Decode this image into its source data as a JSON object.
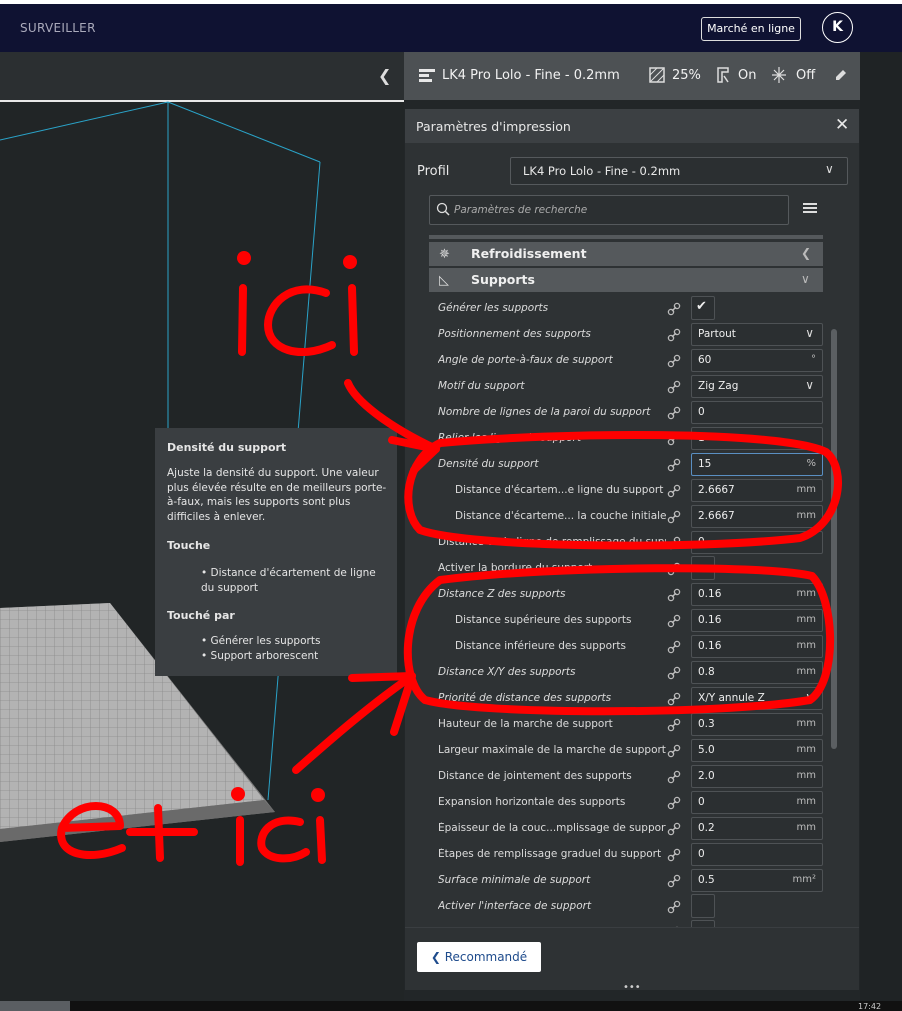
{
  "topbar": {
    "monitor": "SURVEILLER",
    "market": "Marché en ligne",
    "avatar": "K"
  },
  "header": {
    "profile": "LK4 Pro Lolo - Fine - 0.2mm",
    "infill": "25%",
    "support": "On",
    "adhesion": "Off"
  },
  "tooltip": {
    "title": "Densité du support",
    "description": "Ajuste la densité du support. Une valeur plus élevée résulte en de meilleurs porte-à-faux, mais les supports sont plus difficiles à enlever.",
    "affects_title": "Touche",
    "affects": [
      "• Distance d'écartement de ligne du support"
    ],
    "affected_by_title": "Touché par",
    "affected_by": [
      "• Générer les supports",
      "• Support arborescent"
    ]
  },
  "panel": {
    "title": "Paramètres d'impression",
    "profile_label": "Profil",
    "profile_value": "LK4 Pro Lolo - Fine - 0.2mm",
    "search_placeholder": "Paramètres de recherche",
    "categories": {
      "cooling": "Refroidissement",
      "supports": "Supports"
    },
    "rows": [
      {
        "label": "Générer les supports",
        "type": "check",
        "checked": true
      },
      {
        "label": "Positionnement des supports",
        "type": "select",
        "value": "Partout"
      },
      {
        "label": "Angle de porte-à-faux de support",
        "value": "60",
        "unit": "°"
      },
      {
        "label": "Motif du support",
        "type": "select",
        "value": "Zig Zag"
      },
      {
        "label": "Nombre de lignes de la paroi du support",
        "value": "0"
      },
      {
        "label": "Relier les lignes de support",
        "value": "1"
      },
      {
        "label": "Densité du support",
        "value": "15",
        "unit": "%",
        "focus": true
      },
      {
        "label": "Distance d'écartem...e ligne du support",
        "value": "2.6667",
        "unit": "mm",
        "indent": true
      },
      {
        "label": "Distance d'écarteme... la couche initiale",
        "value": "2.6667",
        "unit": "mm",
        "indent": true
      },
      {
        "label": "Distance de la ligne de remplissage du support",
        "value": "0"
      },
      {
        "label": "Activer la bordure du support",
        "type": "check",
        "checked": false
      },
      {
        "label": "Distance Z des supports",
        "value": "0.16",
        "unit": "mm"
      },
      {
        "label": "Distance supérieure des supports",
        "value": "0.16",
        "unit": "mm",
        "indent": true
      },
      {
        "label": "Distance inférieure des supports",
        "value": "0.16",
        "unit": "mm",
        "indent": true
      },
      {
        "label": "Distance X/Y des supports",
        "value": "0.8",
        "unit": "mm"
      },
      {
        "label": "Priorité de distance des supports",
        "type": "select",
        "value": "X/Y annule Z"
      },
      {
        "label": "Hauteur de la marche de support",
        "value": "0.3",
        "unit": "mm"
      },
      {
        "label": "Largeur maximale de la marche de support",
        "value": "5.0",
        "unit": "mm"
      },
      {
        "label": "Distance de jointement des supports",
        "value": "2.0",
        "unit": "mm"
      },
      {
        "label": "Expansion horizontale des supports",
        "value": "0",
        "unit": "mm"
      },
      {
        "label": "Épaisseur de la couc...mplissage de support",
        "value": "0.2",
        "unit": "mm"
      },
      {
        "label": "Étapes de remplissage graduel du support",
        "value": "0"
      },
      {
        "label": "Surface minimale de support",
        "value": "0.5",
        "unit": "mm²"
      },
      {
        "label": "Activer l'interface de support",
        "type": "check",
        "checked": false
      },
      {
        "label": "Activer les plafonds de support",
        "type": "check",
        "checked": false
      }
    ],
    "recommended": "Recommandé"
  },
  "annotations": {
    "text1": "ici",
    "text2": "et ici"
  },
  "clock": "17:42",
  "colors": {
    "accent": "#1e4b8c",
    "annotation": "#ff0000",
    "topbar": "#0f1232"
  }
}
